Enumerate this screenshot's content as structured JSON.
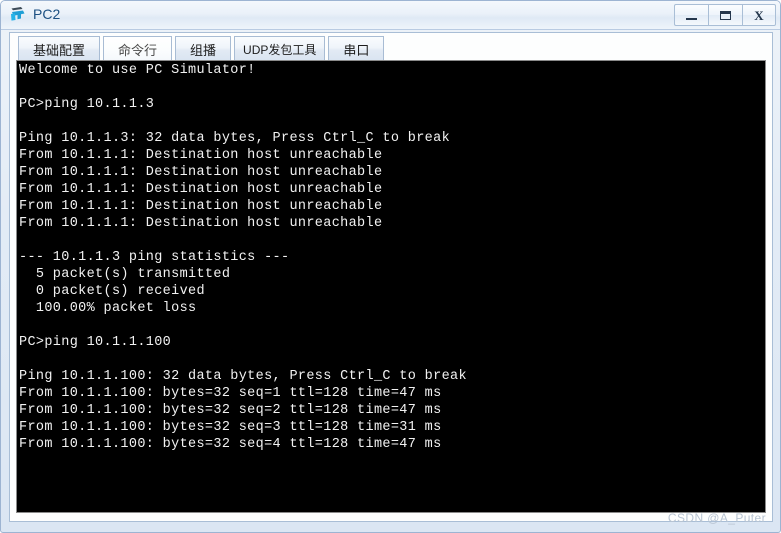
{
  "window": {
    "title": "PC2",
    "icon": "pc-terminal-icon",
    "controls": {
      "minimize": "—",
      "maximize": "▭",
      "close": "X"
    }
  },
  "tabs": [
    {
      "label": "基础配置",
      "name": "tab-basic-config",
      "active": false,
      "small": false
    },
    {
      "label": "命令行",
      "name": "tab-command-line",
      "active": true,
      "small": false
    },
    {
      "label": "组播",
      "name": "tab-multicast",
      "active": false,
      "small": false
    },
    {
      "label": "UDP发包工具",
      "name": "tab-udp-sender",
      "active": false,
      "small": true
    },
    {
      "label": "串口",
      "name": "tab-serial-port",
      "active": false,
      "small": false
    }
  ],
  "terminal": {
    "content": "Welcome to use PC Simulator!\n\nPC>ping 10.1.1.3\n\nPing 10.1.1.3: 32 data bytes, Press Ctrl_C to break\nFrom 10.1.1.1: Destination host unreachable\nFrom 10.1.1.1: Destination host unreachable\nFrom 10.1.1.1: Destination host unreachable\nFrom 10.1.1.1: Destination host unreachable\nFrom 10.1.1.1: Destination host unreachable\n\n--- 10.1.1.3 ping statistics ---\n  5 packet(s) transmitted\n  0 packet(s) received\n  100.00% packet loss\n\nPC>ping 10.1.1.100\n\nPing 10.1.1.100: 32 data bytes, Press Ctrl_C to break\nFrom 10.1.1.100: bytes=32 seq=1 ttl=128 time=47 ms\nFrom 10.1.1.100: bytes=32 seq=2 ttl=128 time=47 ms\nFrom 10.1.1.100: bytes=32 seq=3 ttl=128 time=31 ms\nFrom 10.1.1.100: bytes=32 seq=4 ttl=128 time=47 ms",
    "lines": [
      "Welcome to use PC Simulator!",
      "",
      "PC>ping 10.1.1.3",
      "",
      "Ping 10.1.1.3: 32 data bytes, Press Ctrl_C to break",
      "From 10.1.1.1: Destination host unreachable",
      "From 10.1.1.1: Destination host unreachable",
      "From 10.1.1.1: Destination host unreachable",
      "From 10.1.1.1: Destination host unreachable",
      "From 10.1.1.1: Destination host unreachable",
      "",
      "--- 10.1.1.3 ping statistics ---",
      "  5 packet(s) transmitted",
      "  0 packet(s) received",
      "  100.00% packet loss",
      "",
      "PC>ping 10.1.1.100",
      "",
      "Ping 10.1.1.100: 32 data bytes, Press Ctrl_C to break",
      "From 10.1.1.100: bytes=32 seq=1 ttl=128 time=47 ms",
      "From 10.1.1.100: bytes=32 seq=2 ttl=128 time=47 ms",
      "From 10.1.1.100: bytes=32 seq=3 ttl=128 time=31 ms",
      "From 10.1.1.100: bytes=32 seq=4 ttl=128 time=47 ms"
    ]
  },
  "watermark": {
    "text": "CSDN @A_Puter"
  },
  "colors": {
    "terminal_bg": "#000000",
    "terminal_fg": "#f2f2f2",
    "title_text": "#1b4f82",
    "frame": "#a9bed6",
    "watermark": "#b8c4d2"
  }
}
